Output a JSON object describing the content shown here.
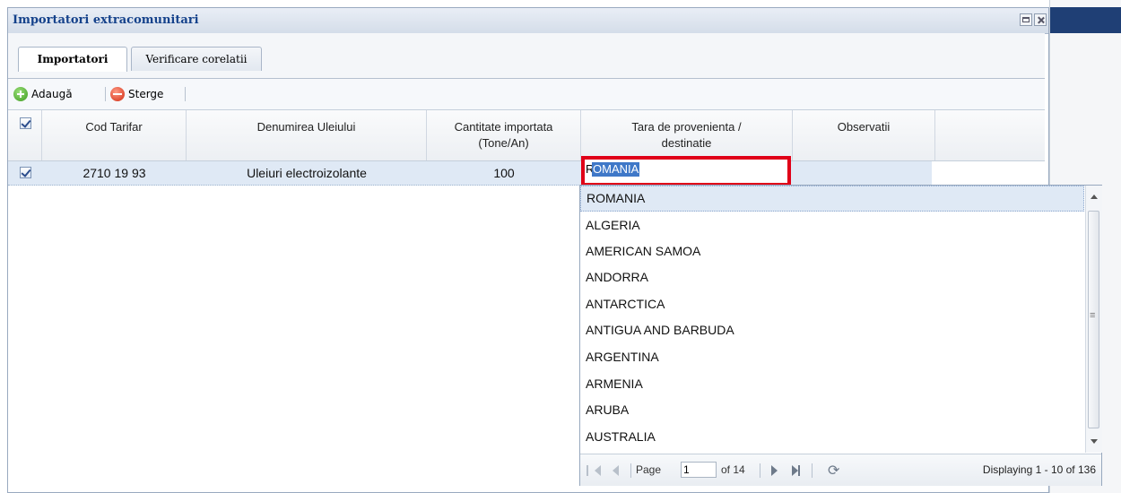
{
  "window": {
    "title": "Importatori extracomunitari"
  },
  "tabs": [
    {
      "label": "Importatori",
      "active": true
    },
    {
      "label": "Verificare corelatii",
      "active": false
    }
  ],
  "toolbar": {
    "add_label": "Adaugă",
    "delete_label": "Sterge"
  },
  "grid": {
    "columns": [
      {
        "label": "Cod Tarifar"
      },
      {
        "label": "Denumirea Uleiului"
      },
      {
        "label": "Cantitate importata (Tone/An)"
      },
      {
        "label": "Tara de provenienta / destinatie"
      },
      {
        "label": "Observatii"
      }
    ],
    "rows": [
      {
        "checked": true,
        "cod": "2710 19 93",
        "denumire": "Uleiuri electroizolante",
        "cantitate": "100",
        "tara": "ROMANIA",
        "observatii": ""
      }
    ]
  },
  "editor": {
    "value": "ROMANIA",
    "first_char": "R",
    "selected_text": "OMANIA"
  },
  "dropdown": {
    "options": [
      "ROMANIA",
      "ALGERIA",
      "AMERICAN SAMOA",
      "ANDORRA",
      "ANTARCTICA",
      "ANTIGUA AND BARBUDA",
      "ARGENTINA",
      "ARMENIA",
      "ARUBA",
      "AUSTRALIA"
    ],
    "selected_index": 0
  },
  "pager": {
    "page_label": "Page",
    "page_value": "1",
    "of_label": "of 14",
    "display_text": "Displaying 1 - 10 of 136"
  },
  "colors": {
    "accent": "#15428b",
    "highlight": "#dfe9f5",
    "editor_border": "#e00018",
    "selection": "#3f78c8"
  }
}
